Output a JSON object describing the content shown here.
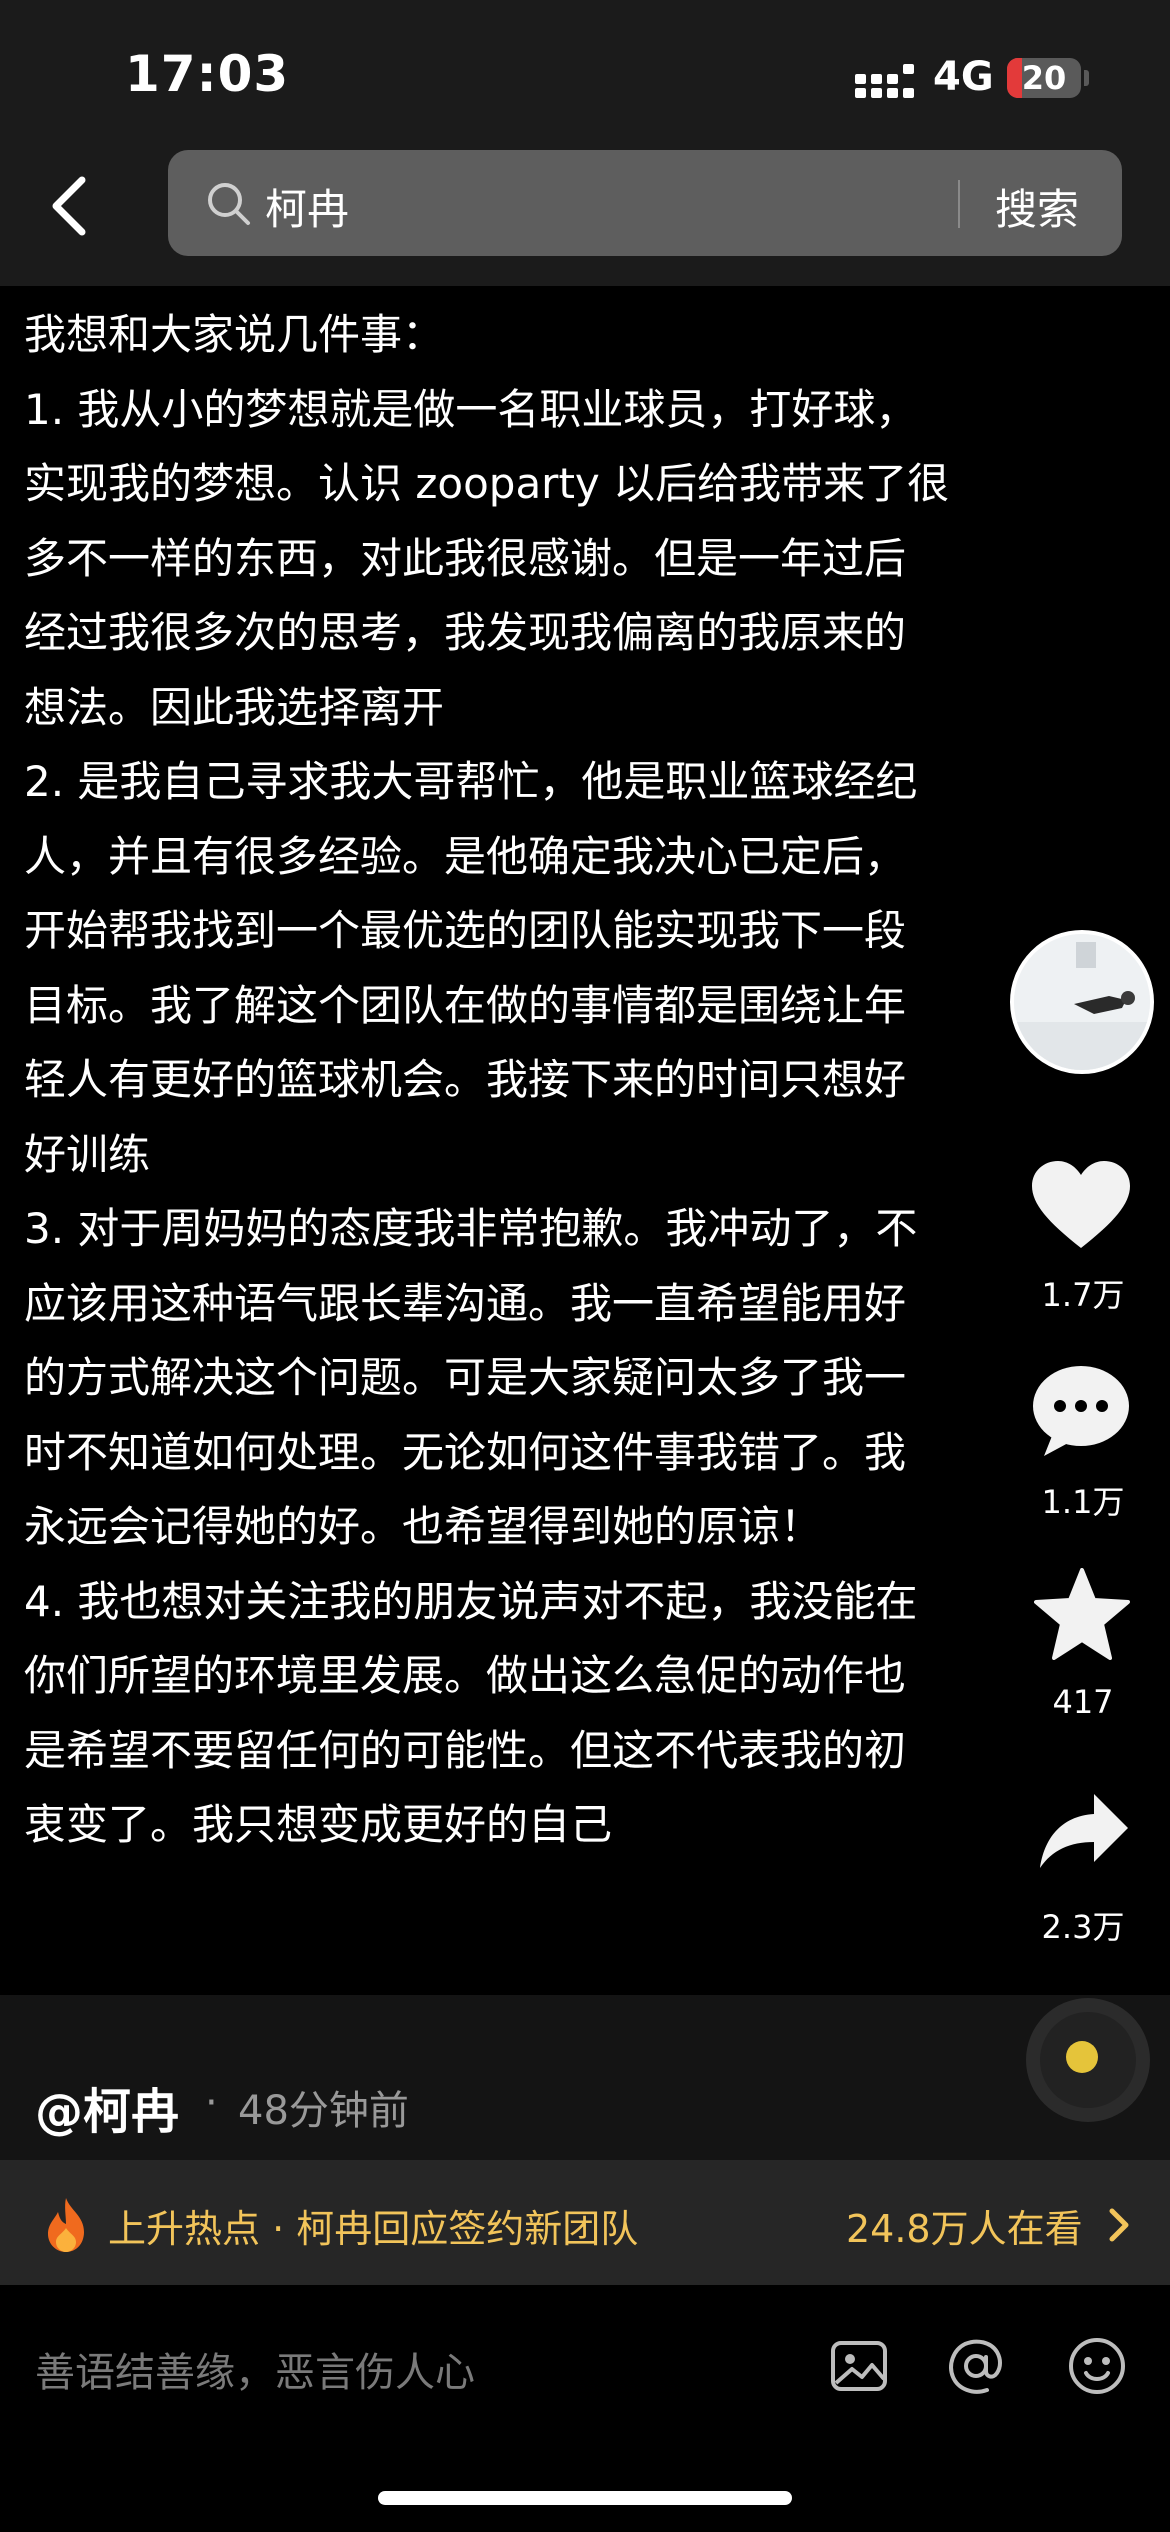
{
  "status_bar": {
    "time": "17:03",
    "network": "4G",
    "battery": "20",
    "battery_level_percent": 20
  },
  "search": {
    "query": "柯冉",
    "button_label": "搜索"
  },
  "post_lines": [
    "我想和大家说几件事：",
    "1. 我从小的梦想就是做一名职业球员，打好球，",
    "实现我的梦想。认识 zooparty 以后给我带来了很",
    "多不一样的东西，对此我很感谢。但是一年过后",
    "经过我很多次的思考，我发现我偏离的我原来的",
    "想法。因此我选择离开",
    "2. 是我自己寻求我大哥帮忙，他是职业篮球经纪",
    "人，并且有很多经验。是他确定我决心已定后，",
    "开始帮我找到一个最优选的团队能实现我下一段",
    "目标。我了解这个团队在做的事情都是围绕让年",
    "轻人有更好的篮球机会。我接下来的时间只想好",
    "好训练",
    "3. 对于周妈妈的态度我非常抱歉。我冲动了，不",
    "应该用这种语气跟长辈沟通。我一直希望能用好",
    "的方式解决这个问题。可是大家疑问太多了我一",
    "时不知道如何处理。无论如何这件事我错了。我",
    "永远会记得她的好。也希望得到她的原谅！",
    "4. 我也想对关注我的朋友说声对不起，我没能在",
    "你们所望的环境里发展。做出这么急促的动作也",
    "是希望不要留任何的可能性。但这不代表我的初",
    "衷变了。我只想变成更好的自己"
  ],
  "actions": {
    "like_count": "1.7万",
    "comment_count": "1.1万",
    "favorite_count": "417",
    "share_count": "2.3万",
    "icons": [
      "heart-icon",
      "comment-icon",
      "star-icon",
      "share-icon"
    ]
  },
  "author": {
    "name": "@柯冉",
    "separator": "·",
    "time_ago": "48分钟前"
  },
  "hot": {
    "topic": "上升热点 · 柯冉回应签约新团队",
    "viewers": "24.8万人在看"
  },
  "comment": {
    "placeholder": "善语结善缘，恶言伤人心"
  },
  "colors": {
    "hot_accent": "#f2c45a",
    "battery_low": "#e33a3a",
    "search_box": "#5e5e5e"
  }
}
